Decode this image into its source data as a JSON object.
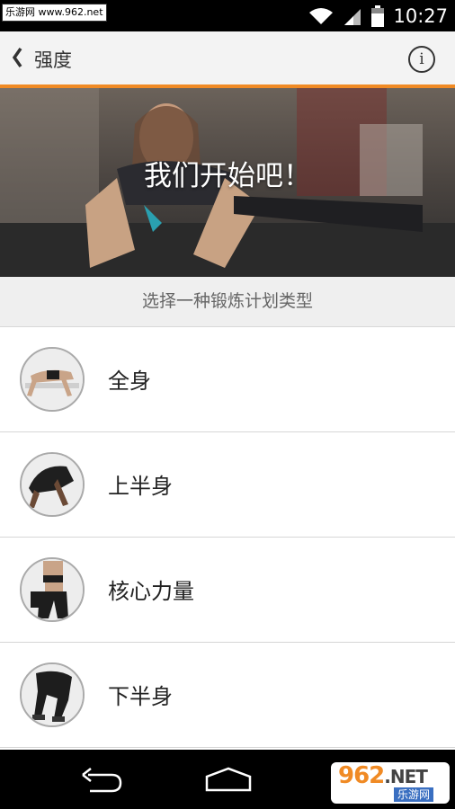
{
  "status_bar": {
    "watermark": "乐游网 www.962.net",
    "time": "10:27",
    "icons": [
      "wifi-icon",
      "signal-icon",
      "battery-icon"
    ]
  },
  "app_bar": {
    "title": "强度",
    "accent_color": "#f08a24",
    "icons": [
      "chevron-left-icon",
      "info-icon"
    ],
    "info_glyph": "i"
  },
  "hero": {
    "title": "我们开始吧！"
  },
  "section": {
    "subtitle": "选择一种锻炼计划类型"
  },
  "workout_types": [
    {
      "label": "全身"
    },
    {
      "label": "上半身"
    },
    {
      "label": "核心力量"
    },
    {
      "label": "下半身"
    }
  ],
  "nav_bar": {
    "icons": [
      "back-arrow-icon",
      "home-icon"
    ],
    "watermark_number": "962",
    "watermark_net": ".NET",
    "watermark_text": "乐游网"
  }
}
